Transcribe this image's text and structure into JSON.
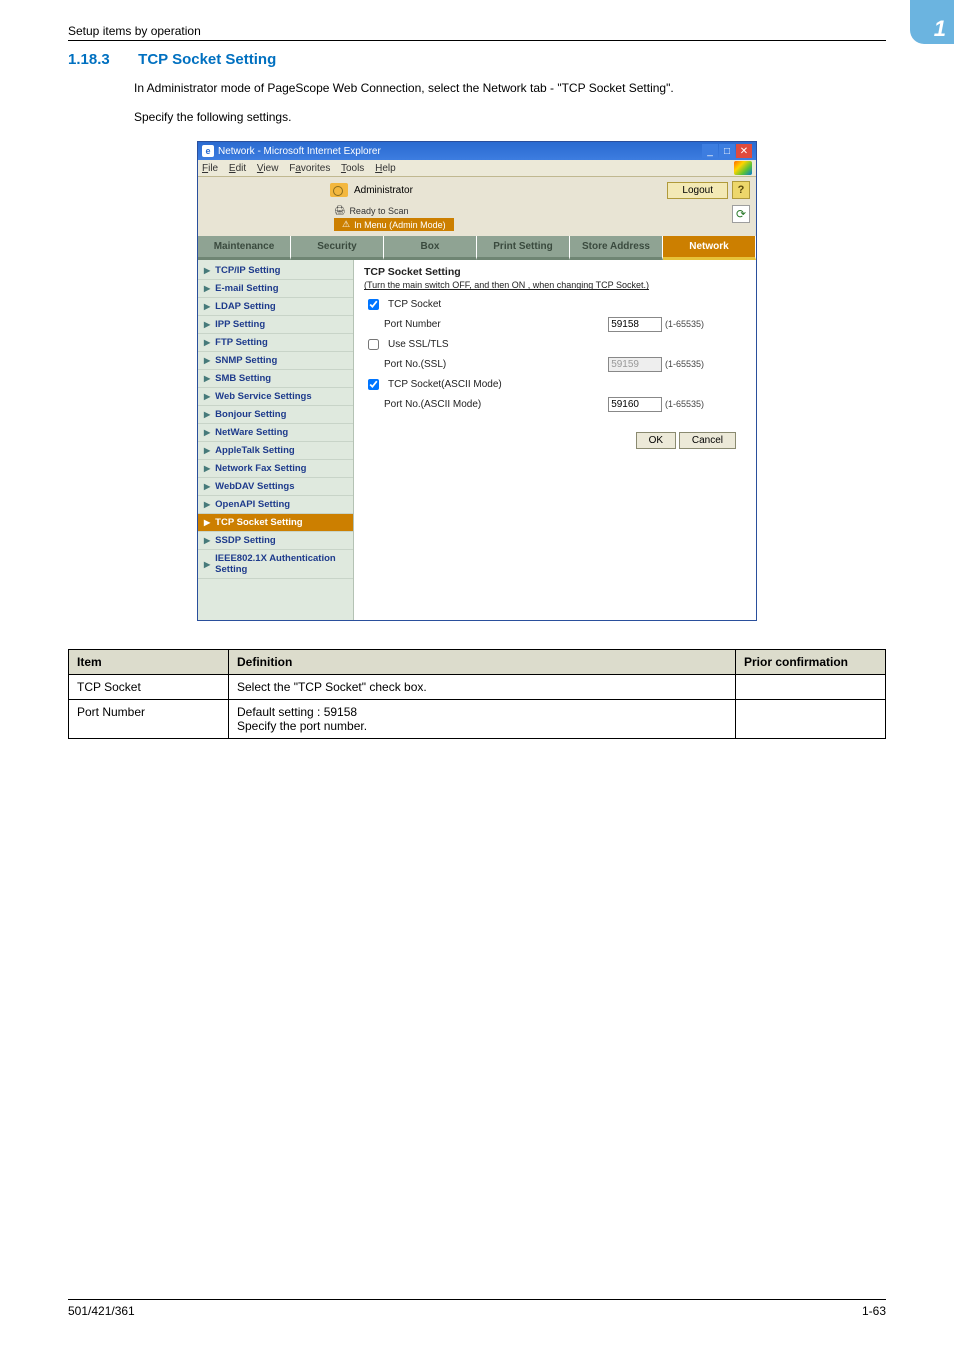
{
  "header": {
    "breadcrumb": "Setup items by operation",
    "chapter_number": "1"
  },
  "section": {
    "number": "1.18.3",
    "title": "TCP Socket Setting",
    "line1": "In Administrator mode of PageScope Web Connection, select the Network tab - \"TCP Socket Setting\".",
    "line2": "Specify the following settings."
  },
  "ie": {
    "title": "Network - Microsoft Internet Explorer",
    "menus": {
      "file": "File",
      "edit": "Edit",
      "view": "View",
      "favorites": "Favorites",
      "tools": "Tools",
      "help": "Help"
    },
    "admin_label": "Administrator",
    "logout": "Logout",
    "help": "?",
    "status_text": "Ready to Scan",
    "mode_text": "In Menu (Admin Mode)"
  },
  "tabs": {
    "maintenance": "Maintenance",
    "security": "Security",
    "box": "Box",
    "print": "Print Setting",
    "store": "Store Address",
    "network": "Network"
  },
  "nav": {
    "items": [
      {
        "label": "TCP/IP Setting"
      },
      {
        "label": "E-mail Setting"
      },
      {
        "label": "LDAP Setting"
      },
      {
        "label": "IPP Setting"
      },
      {
        "label": "FTP Setting"
      },
      {
        "label": "SNMP Setting"
      },
      {
        "label": "SMB Setting"
      },
      {
        "label": "Web Service Settings"
      },
      {
        "label": "Bonjour Setting"
      },
      {
        "label": "NetWare Setting"
      },
      {
        "label": "AppleTalk Setting"
      },
      {
        "label": "Network Fax Setting"
      },
      {
        "label": "WebDAV Settings"
      },
      {
        "label": "OpenAPI Setting"
      },
      {
        "label": "TCP Socket Setting"
      },
      {
        "label": "SSDP Setting"
      },
      {
        "label": "IEEE802.1X Authentication Setting"
      }
    ]
  },
  "form": {
    "title": "TCP Socket Setting",
    "note": "(Turn the main switch OFF, and then ON , when changing TCP Socket.)",
    "tcp_socket_label": "TCP Socket",
    "port_number_label": "Port Number",
    "port_number_value": "59158",
    "range1": "(1-65535)",
    "use_ssl_label": "Use SSL/TLS",
    "port_ssl_label": "Port No.(SSL)",
    "port_ssl_value": "59159",
    "range2": "(1-65535)",
    "ascii_mode_label": "TCP Socket(ASCII Mode)",
    "port_ascii_label": "Port No.(ASCII Mode)",
    "port_ascii_value": "59160",
    "range3": "(1-65535)",
    "ok": "OK",
    "cancel": "Cancel"
  },
  "def_table": {
    "h1": "Item",
    "h2": "Definition",
    "h3": "Prior confirmation",
    "r1c1": "TCP Socket",
    "r1c2": "Select the \"TCP Socket\" check box.",
    "r2c1": "Port Number",
    "r2c2": "Default setting : 59158\nSpecify the port number."
  },
  "footer": {
    "left": "501/421/361",
    "right": "1-63"
  }
}
